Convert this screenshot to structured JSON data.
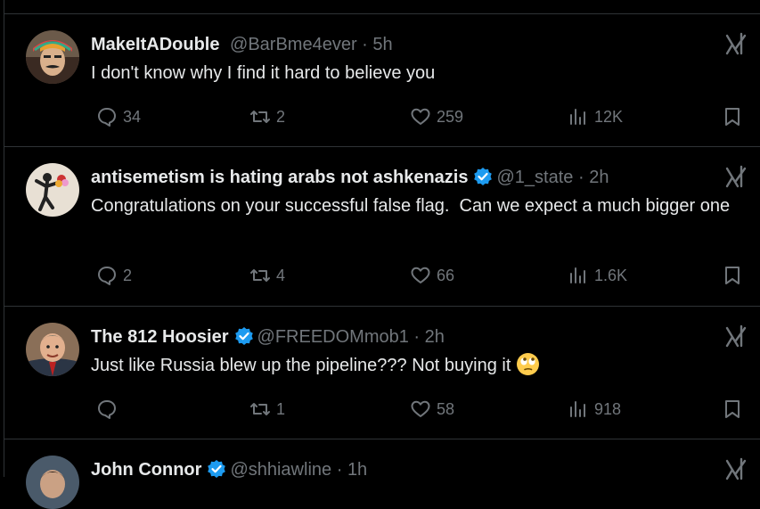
{
  "tweets": [
    {
      "name": "MakeItADouble",
      "handle": "@BarBme4ever",
      "separator": "·",
      "time": "5h",
      "verified": false,
      "text": "I don't know why I find it hard to believe you",
      "emoji": "",
      "replies": "34",
      "reposts": "2",
      "likes": "259",
      "views": "12K"
    },
    {
      "name": "antisemetism is hating arabs not ashkenazis",
      "handle": "@1_state",
      "separator": "·",
      "time": "2h",
      "verified": true,
      "text": "Congratulations on your successful false flag.  Can we expect a much bigger one",
      "emoji": "",
      "replies": "2",
      "reposts": "4",
      "likes": "66",
      "views": "1.6K"
    },
    {
      "name": "The 812 Hoosier",
      "handle": "@FREEDOMmob1",
      "separator": "·",
      "time": "2h",
      "verified": true,
      "text": "Just like Russia blew up the pipeline??? Not buying it",
      "emoji": "face-with-rolling-eyes",
      "replies": "",
      "reposts": "1",
      "likes": "58",
      "views": "918"
    },
    {
      "name": "John Connor",
      "handle": "@shhiawline",
      "separator": "·",
      "time": "1h",
      "verified": true
    }
  ],
  "icons": {
    "reply": "reply-icon",
    "repost": "repost-icon",
    "like": "like-icon",
    "views": "views-icon",
    "bookmark": "bookmark-icon",
    "grok": "grok-icon",
    "verified": "verified-badge-icon"
  },
  "colors": {
    "background": "#000000",
    "text": "#e7e9ea",
    "muted": "#71767b",
    "border": "#2f3336",
    "verified": "#1d9bf0"
  }
}
